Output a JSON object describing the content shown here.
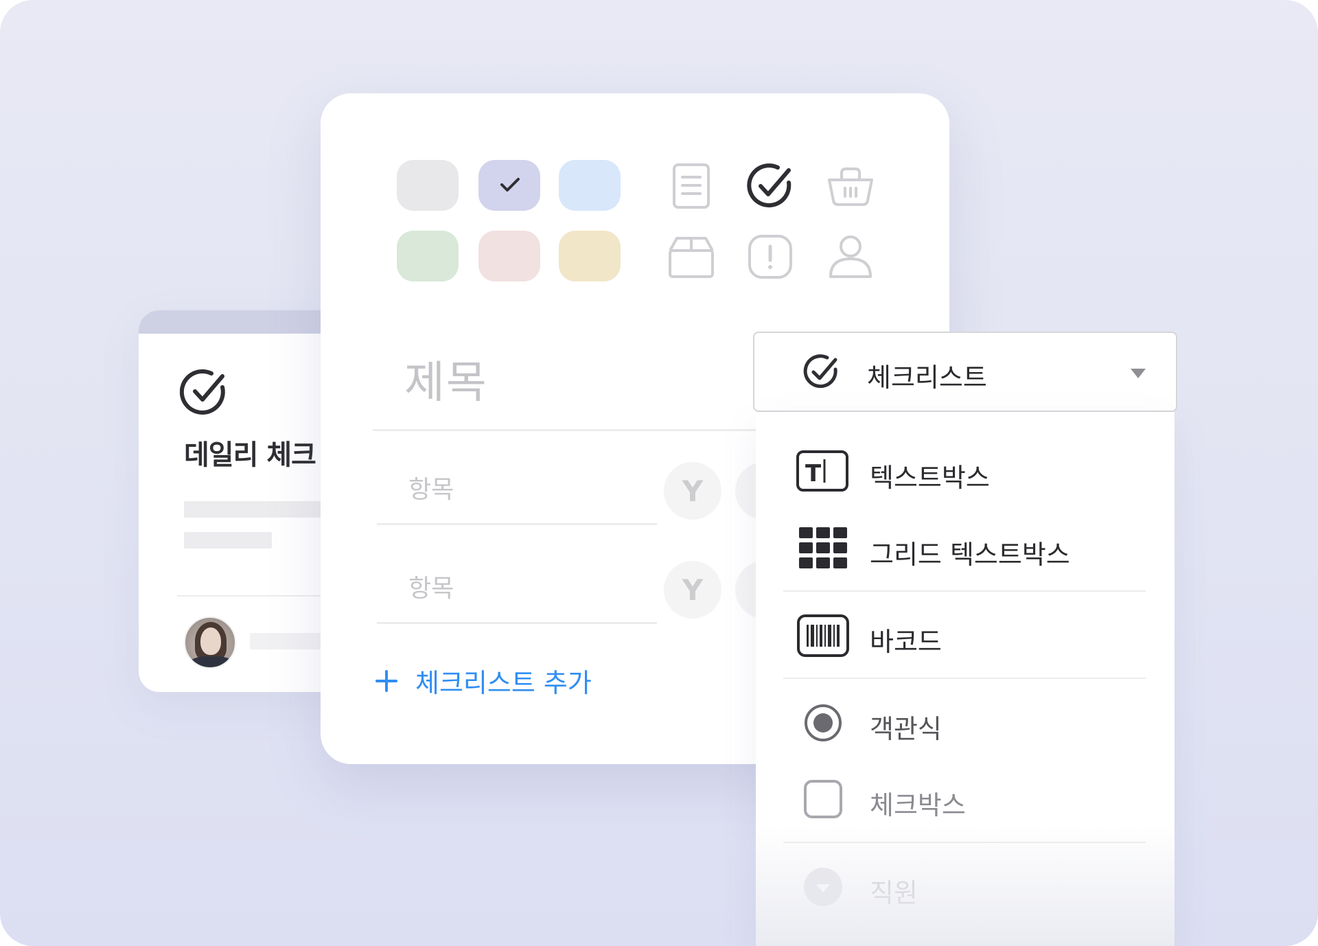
{
  "back_card": {
    "title": "데일리 체크"
  },
  "editor": {
    "color_swatches": [
      {
        "color": "#e8e8ea",
        "selected": false
      },
      {
        "color": "#d2d3ec",
        "selected": true
      },
      {
        "color": "#d8e7fa",
        "selected": false
      },
      {
        "color": "#d9e8d8",
        "selected": false
      },
      {
        "color": "#f1e1e1",
        "selected": false
      },
      {
        "color": "#f1e6c8",
        "selected": false
      }
    ],
    "type_icons": [
      "document-icon",
      "checklist-icon",
      "basket-icon",
      "box-icon",
      "alert-icon",
      "person-icon"
    ],
    "selected_type_icon": "checklist-icon",
    "title_placeholder": "제목",
    "items": [
      {
        "placeholder": "항목",
        "yes_label": "Y"
      },
      {
        "placeholder": "항목",
        "yes_label": "Y"
      }
    ],
    "add_checklist_label": "체크리스트 추가",
    "accent_color": "#2f8ef2"
  },
  "type_select": {
    "selected_label": "체크리스트",
    "selected_icon": "checklist-icon",
    "options": [
      {
        "label": "텍스트박스",
        "icon": "textbox-icon"
      },
      {
        "label": "그리드 텍스트박스",
        "icon": "grid-icon"
      },
      {
        "label": "바코드",
        "icon": "barcode-icon"
      },
      {
        "label": "객관식",
        "icon": "radio-icon"
      },
      {
        "label": "체크박스",
        "icon": "checkbox-icon"
      },
      {
        "label": "직원",
        "icon": "employee-dropdown-icon"
      }
    ]
  }
}
